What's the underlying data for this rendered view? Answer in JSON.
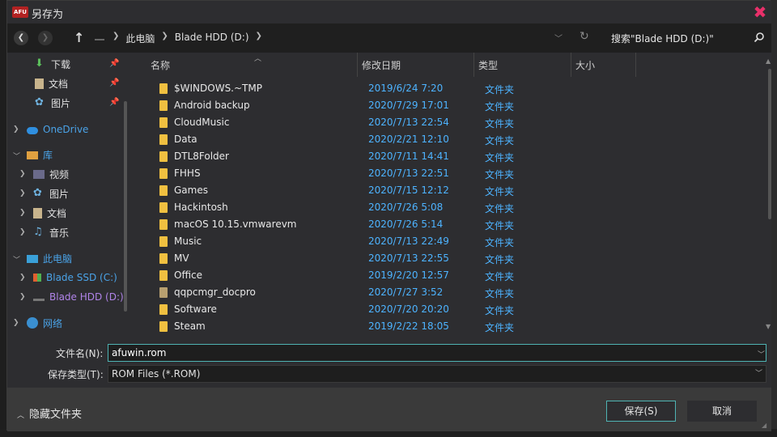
{
  "window": {
    "title": "另存为",
    "logo_text": "AFU",
    "close_glyph": "✖"
  },
  "navbar": {
    "breadcrumbs": [
      "此电脑",
      "Blade HDD (D:)"
    ],
    "search_label": "搜索\"Blade HDD (D:)\""
  },
  "sidebar": {
    "items": [
      {
        "label": "下载",
        "icon": "download-icon",
        "pinned": true
      },
      {
        "label": "文档",
        "icon": "document-icon",
        "pinned": true
      },
      {
        "label": "图片",
        "icon": "pictures-icon",
        "pinned": true
      },
      {
        "label": "OneDrive",
        "icon": "cloud-icon"
      },
      {
        "label": "库",
        "icon": "library-icon"
      },
      {
        "label": "视频",
        "icon": "video-icon"
      },
      {
        "label": "图片",
        "icon": "pictures-icon"
      },
      {
        "label": "文档",
        "icon": "document-icon"
      },
      {
        "label": "音乐",
        "icon": "music-icon"
      },
      {
        "label": "此电脑",
        "icon": "computer-icon"
      },
      {
        "label": "Blade SSD (C:)",
        "icon": "drive-c-icon"
      },
      {
        "label": "Blade HDD (D:)",
        "icon": "drive-d-icon"
      },
      {
        "label": "网络",
        "icon": "network-icon"
      }
    ]
  },
  "filelist": {
    "columns": [
      "名称",
      "修改日期",
      "类型",
      "大小"
    ],
    "rows": [
      {
        "name": "$WINDOWS.~TMP",
        "date": "2019/6/24 7:20",
        "type": "文件夹"
      },
      {
        "name": "Android backup",
        "date": "2020/7/29 17:01",
        "type": "文件夹"
      },
      {
        "name": "CloudMusic",
        "date": "2020/7/13 22:54",
        "type": "文件夹"
      },
      {
        "name": "Data",
        "date": "2020/2/21 12:10",
        "type": "文件夹"
      },
      {
        "name": "DTL8Folder",
        "date": "2020/7/11 14:41",
        "type": "文件夹"
      },
      {
        "name": "FHHS",
        "date": "2020/7/13 22:51",
        "type": "文件夹"
      },
      {
        "name": "Games",
        "date": "2020/7/15 12:12",
        "type": "文件夹"
      },
      {
        "name": "Hackintosh",
        "date": "2020/7/26 5:08",
        "type": "文件夹"
      },
      {
        "name": "macOS 10.15.vmwarevm",
        "date": "2020/7/26 5:14",
        "type": "文件夹"
      },
      {
        "name": "Music",
        "date": "2020/7/13 22:49",
        "type": "文件夹"
      },
      {
        "name": "MV",
        "date": "2020/7/13 22:55",
        "type": "文件夹"
      },
      {
        "name": "Office",
        "date": "2019/2/20 12:57",
        "type": "文件夹"
      },
      {
        "name": "qqpcmgr_docpro",
        "date": "2020/7/27 3:52",
        "type": "文件夹"
      },
      {
        "name": "Software",
        "date": "2020/7/20 20:20",
        "type": "文件夹"
      },
      {
        "name": "Steam",
        "date": "2019/2/22 18:05",
        "type": "文件夹"
      }
    ]
  },
  "form": {
    "filename_label": "文件名(N):",
    "filename_value": "afuwin.rom",
    "filetype_label": "保存类型(T):",
    "filetype_value": "ROM Files (*.ROM)"
  },
  "footer": {
    "hide_folders_label": "隐藏文件夹",
    "save_label": "保存(S)",
    "cancel_label": "取消"
  },
  "colors": {
    "accent": "#4fb3b3",
    "date_text": "#4db3ff",
    "folder": "#f0c040"
  }
}
